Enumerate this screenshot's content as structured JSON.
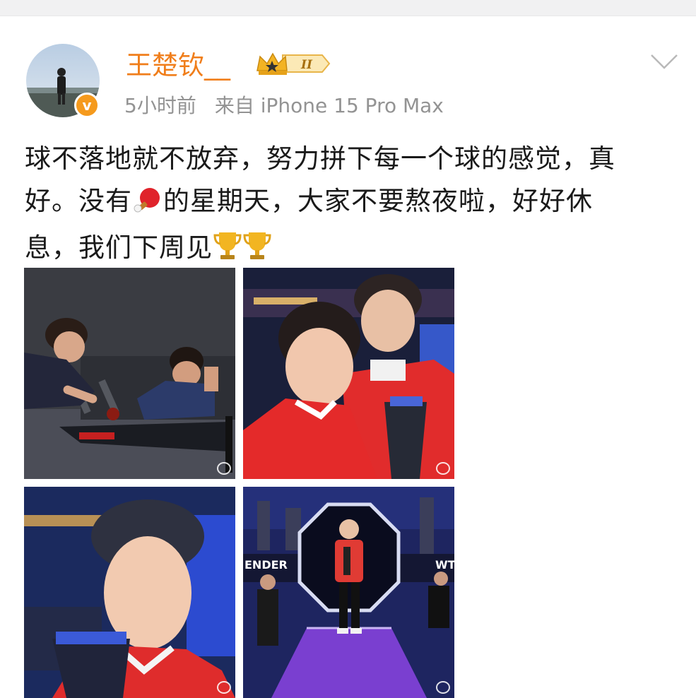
{
  "header": {
    "username": "王楚钦__",
    "badge_level": "II",
    "time": "5小时前",
    "source": "来自 iPhone 15 Pro Max",
    "verified_mark": "v"
  },
  "post": {
    "line1": "球不落地就不放弃，努力拼下每一个球的感觉，真",
    "line2_a": "好。没有",
    "line2_b": "的星期天，大家不要熬夜啦，好好休",
    "line3": "息，我们下周见"
  },
  "photos": {
    "photo4_banner_left": "ENDER",
    "photo4_banner_right": "WT"
  },
  "icons": [
    "crown-badge-icon",
    "chevron-down-icon",
    "ping-pong-icon",
    "trophy-icon",
    "verified-v-icon",
    "weibo-watermark-icon"
  ],
  "colors": {
    "username": "#f07e1b",
    "meta": "#939393",
    "badge": "#f59a1d",
    "text": "#1a1a1a"
  }
}
